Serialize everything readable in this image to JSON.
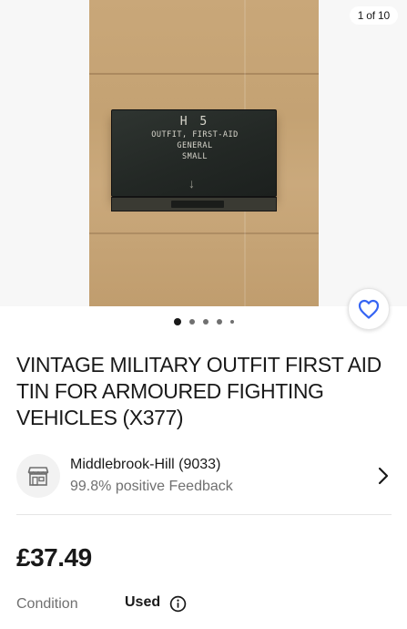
{
  "gallery": {
    "counter": "1 of 10",
    "total_images": 10,
    "current_index": 1,
    "photo": {
      "tin_code": "H 5",
      "tin_line1": "OUTFIT, FIRST-AID",
      "tin_line2": "GENERAL",
      "tin_line3": "SMALL"
    }
  },
  "listing": {
    "title": "VINTAGE MILITARY OUTFIT FIRST AID TIN FOR ARMOURED FIGHTING VEHICLES (X377)",
    "price": "£37.49",
    "condition_label": "Condition",
    "condition_value": "Used"
  },
  "seller": {
    "name": "Middlebrook-Hill (9033)",
    "feedback": "99.8% positive Feedback"
  },
  "icons": {
    "watch": "heart-icon",
    "seller": "store-icon",
    "chevron": "chevron-right-icon",
    "info": "info-icon"
  },
  "colors": {
    "accent": "#3665f3",
    "text": "#191919",
    "muted": "#707070"
  }
}
